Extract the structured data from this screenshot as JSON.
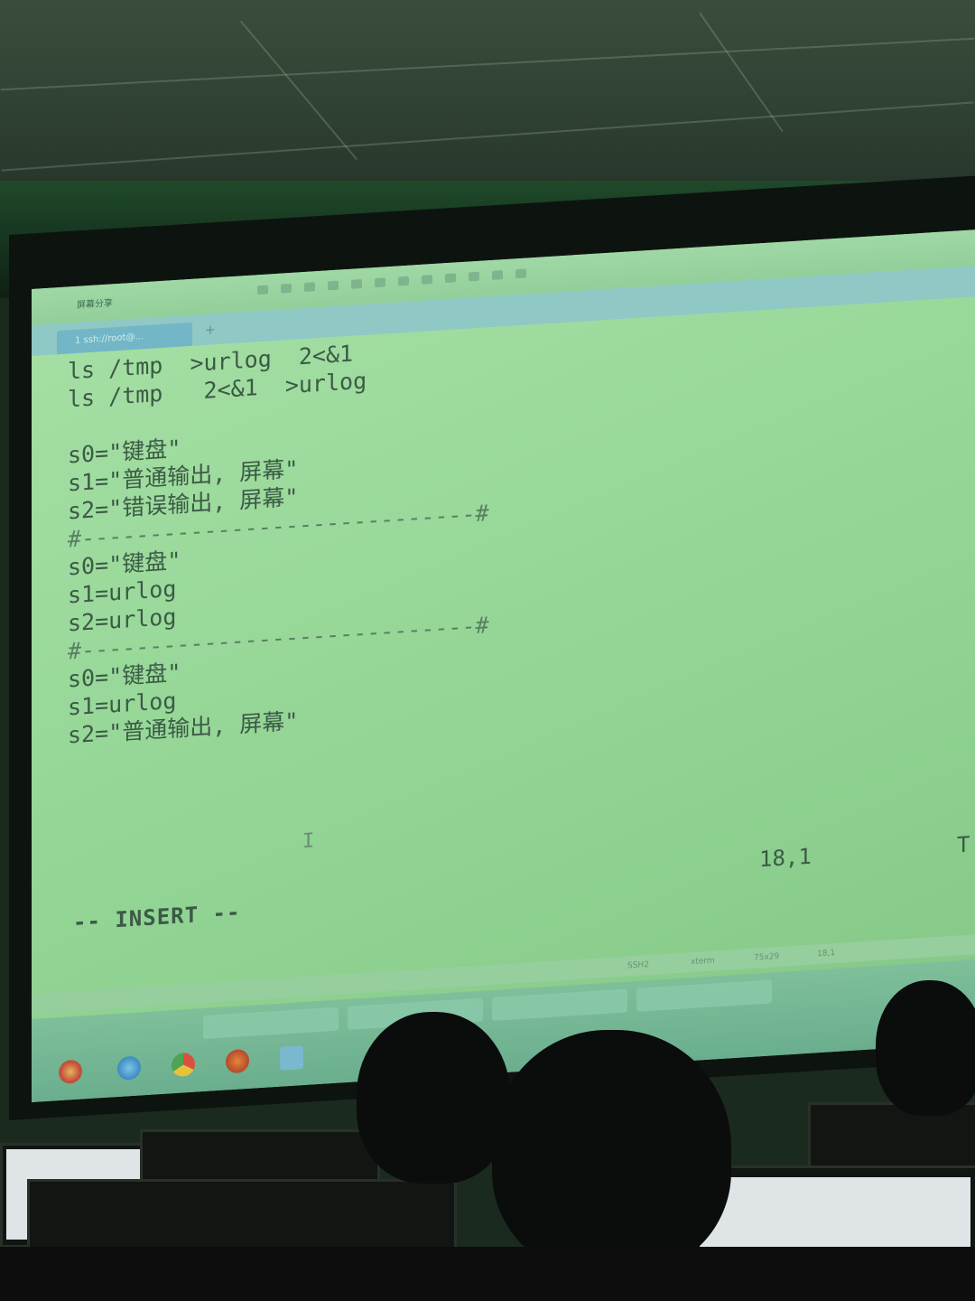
{
  "window": {
    "app_title": "屏幕分享",
    "tab_label": "1 ssh://root@..."
  },
  "editor": {
    "lines": [
      "ls /tmp  >urlog  2<&1",
      "ls /tmp   2<&1  >urlog",
      "",
      "s0=\"键盘\"",
      "s1=\"普通输出, 屏幕\"",
      "s2=\"错误输出, 屏幕\"",
      "#-----------------------------#",
      "s0=\"键盘\"",
      "s1=urlog",
      "s2=urlog",
      "#-----------------------------#",
      "s0=\"键盘\"",
      "s1=urlog",
      "s2=\"普通输出, 屏幕\""
    ],
    "mode": "-- INSERT --",
    "cursor_position": "18,1",
    "truncated_right": "T"
  },
  "statusbar": {
    "items": [
      "SSH2",
      "xterm",
      "75x29",
      "18,1"
    ]
  },
  "colors": {
    "screen_bg": "#9bd99c",
    "text": "#3b5a45",
    "tab": "#72b6c7"
  },
  "icons": [
    "windows-start-icon",
    "ie-icon",
    "chrome-icon",
    "firefox-icon",
    "app-icon"
  ]
}
